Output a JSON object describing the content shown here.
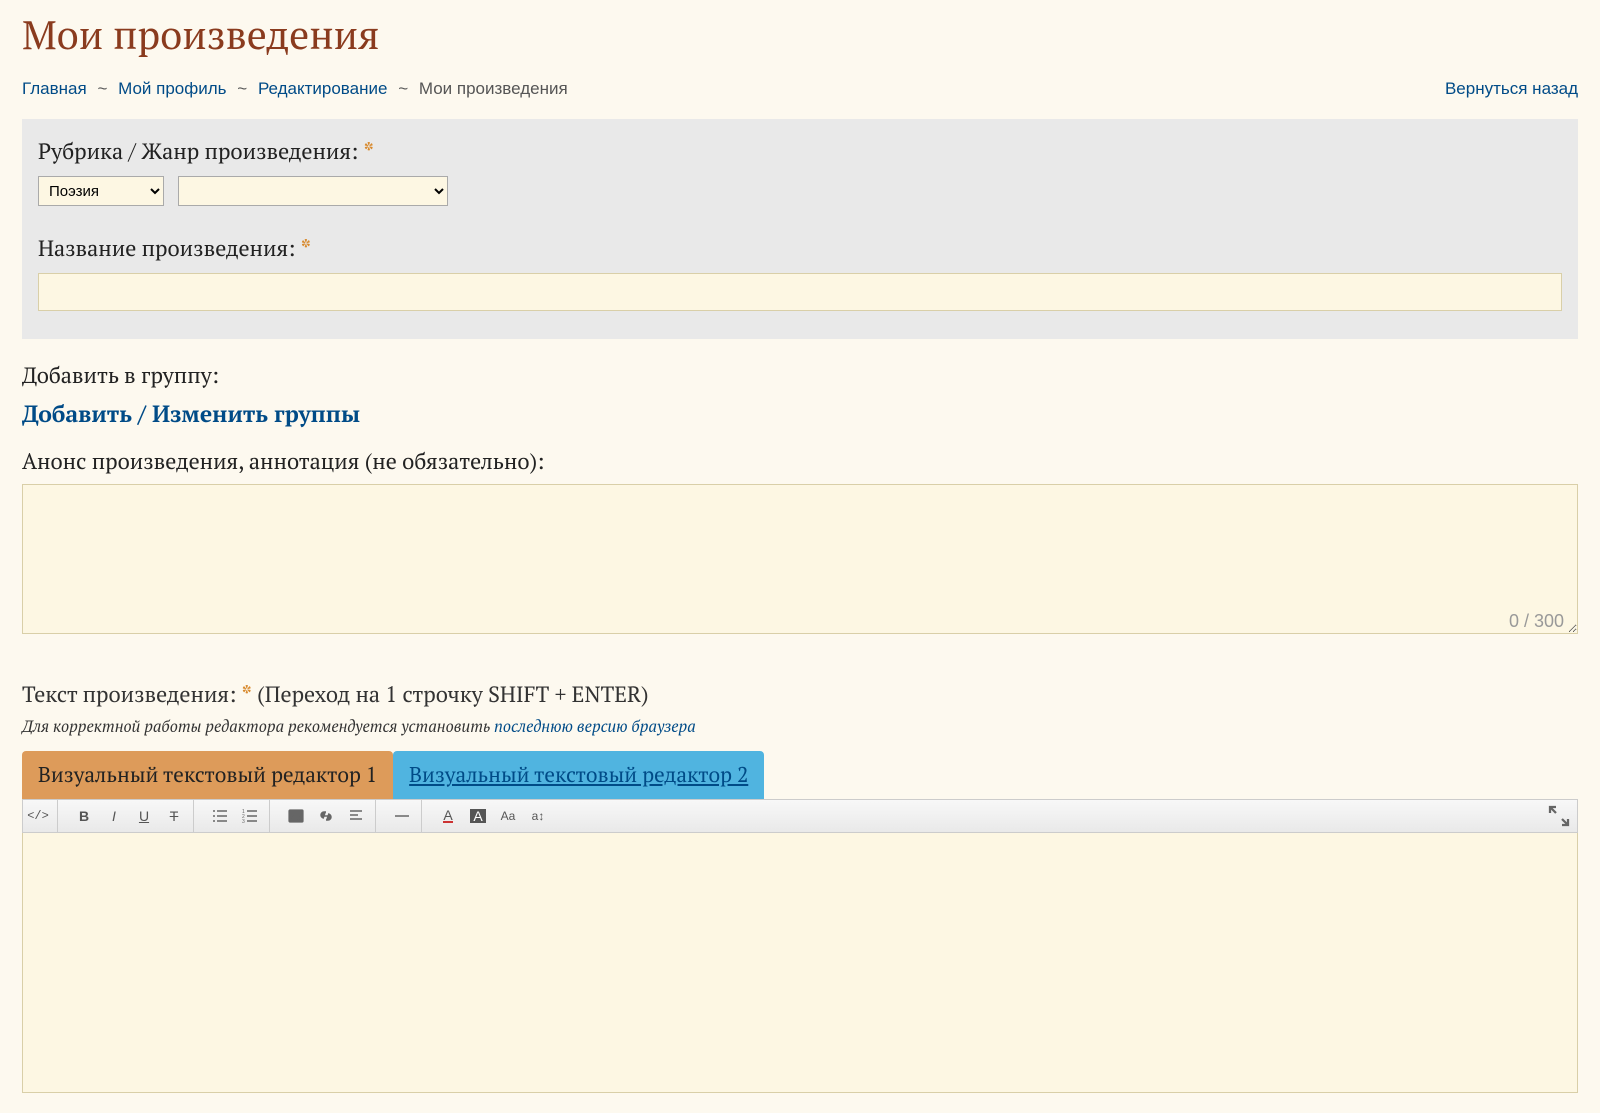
{
  "page": {
    "title": "Мои произведения"
  },
  "breadcrumbs": {
    "home": "Главная",
    "profile": "Мой профиль",
    "editing": "Редактирование",
    "current": "Мои произведения",
    "sep": "~",
    "back": "Вернуться назад"
  },
  "form": {
    "rubric_label": "Рубрика / Жанр произведения:",
    "star": "*",
    "category_selected": "Поэзия",
    "genre_selected": "",
    "title_label": "Название произведения:",
    "title_value": "",
    "group_label": "Добавить в группу:",
    "group_link": "Добавить / Изменить группы",
    "anons_label": "Анонс произведения, аннотация (не обязательно):",
    "anons_value": "",
    "anons_counter": "0 / 300",
    "body_label": "Текст произведения:",
    "body_hint": "(Переход на 1 строчку SHIFT + ENTER)",
    "editor_note_prefix": "Для корректной работы редактора рекомендуется установить ",
    "editor_note_link": "последнюю версию браузера"
  },
  "tabs": {
    "editor1": "Визуальный текстовый редактор 1",
    "editor2": "Визуальный текстовый редактор 2"
  },
  "toolbar": {
    "code": "</>",
    "bold": "B",
    "italic": "I",
    "underline": "U",
    "strike": "T",
    "fontcolor": "A",
    "bgcolor": "A",
    "fontsizeA": "Aa",
    "fontsizeB": "a↕"
  }
}
